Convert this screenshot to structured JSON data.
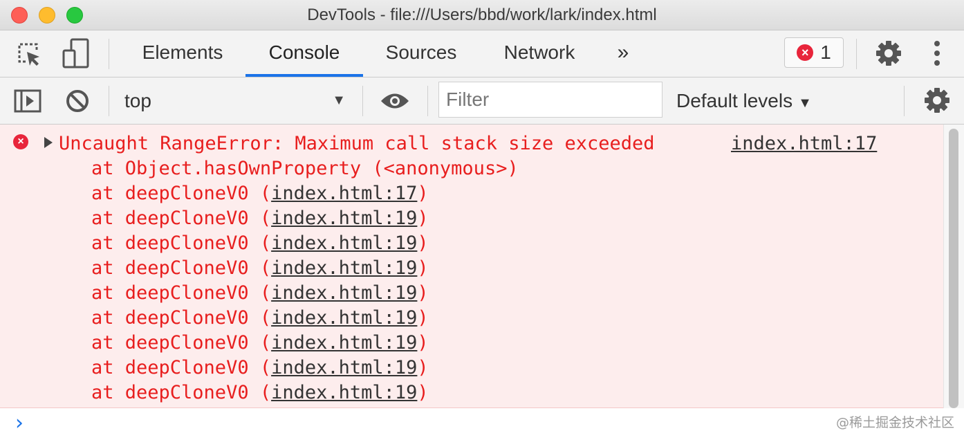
{
  "window": {
    "title": "DevTools - file:///Users/bbd/work/lark/index.html"
  },
  "tabs": [
    {
      "label": "Elements",
      "active": false
    },
    {
      "label": "Console",
      "active": true
    },
    {
      "label": "Sources",
      "active": false
    },
    {
      "label": "Network",
      "active": false
    }
  ],
  "error_count": "1",
  "toolbar": {
    "context": "top",
    "filter_placeholder": "Filter",
    "levels": "Default levels"
  },
  "error": {
    "message": "Uncaught RangeError: Maximum call stack size exceeded",
    "source": "index.html:17",
    "stack": [
      {
        "prefix": "at Object.hasOwnProperty (<anonymous>)",
        "link": "",
        "suffix": ""
      },
      {
        "prefix": "at deepCloneV0 (",
        "link": "index.html:17",
        "suffix": ")"
      },
      {
        "prefix": "at deepCloneV0 (",
        "link": "index.html:19",
        "suffix": ")"
      },
      {
        "prefix": "at deepCloneV0 (",
        "link": "index.html:19",
        "suffix": ")"
      },
      {
        "prefix": "at deepCloneV0 (",
        "link": "index.html:19",
        "suffix": ")"
      },
      {
        "prefix": "at deepCloneV0 (",
        "link": "index.html:19",
        "suffix": ")"
      },
      {
        "prefix": "at deepCloneV0 (",
        "link": "index.html:19",
        "suffix": ")"
      },
      {
        "prefix": "at deepCloneV0 (",
        "link": "index.html:19",
        "suffix": ")"
      },
      {
        "prefix": "at deepCloneV0 (",
        "link": "index.html:19",
        "suffix": ")"
      },
      {
        "prefix": "at deepCloneV0 (",
        "link": "index.html:19",
        "suffix": ")"
      }
    ]
  },
  "watermark": "@稀土掘金技术社区",
  "colors": {
    "error_text": "#e81e1e",
    "error_bg": "#fdeded",
    "accent": "#1a73e8"
  }
}
